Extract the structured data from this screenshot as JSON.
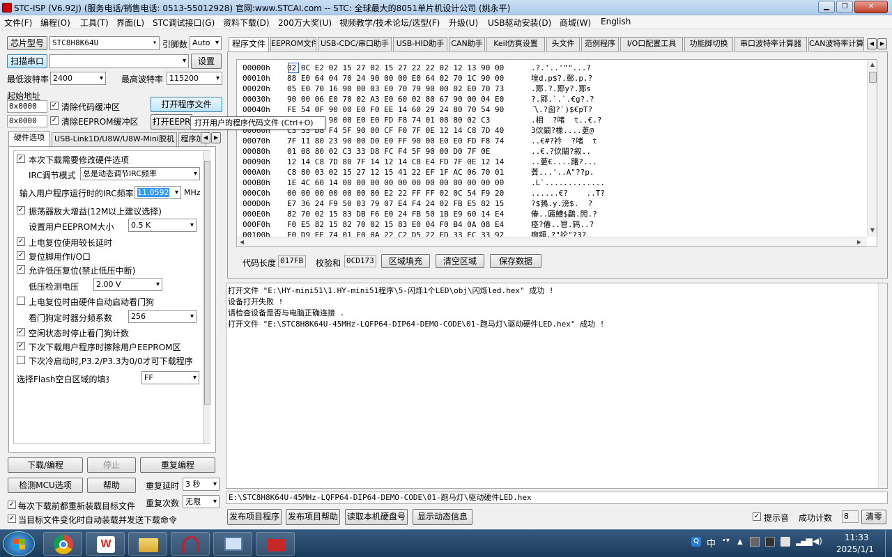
{
  "window": {
    "title": "STC-ISP (V6.92J) (服务电话/销售电话: 0513-55012928) 官网:www.STCAI.com  -- STC: 全球最大的8051单片机设计公司 (姚永平)"
  },
  "menu": [
    "文件(F)",
    "编程(O)",
    "工具(T)",
    "界面(L)",
    "STC调试接口(G)",
    "资料下载(D)",
    "200万大奖(U)",
    "视频教学/技术论坛/选型(F)",
    "升级(U)",
    "USB驱动安装(D)",
    "商城(W)",
    "English"
  ],
  "left": {
    "chip_label": "芯片型号",
    "chip_value": "STC8H8K64U",
    "pins_label": "引脚数",
    "pins_value": "Auto",
    "scan_label": "扫描串口",
    "port_value": "",
    "settings_label": "设置",
    "min_baud_label": "最低波特率",
    "min_baud_value": "2400",
    "max_baud_label": "最高波特率",
    "max_baud_value": "115200",
    "start_addr_label": "起始地址",
    "addr1": "0x0000",
    "clear_code_label": "清除代码缓冲区",
    "addr2": "0x0000",
    "clear_eeprom_label": "清除EEPROM缓冲区",
    "open_prog_label": "打开程序文件",
    "open_eeprom_label": "打开EEPR",
    "tooltip": "打开用户的程序代码文件 (Ctrl+O)",
    "subtabs": [
      "硬件选项",
      "USB-Link1D/U8W/U8W-Mini脱机",
      "程序加"
    ],
    "options": {
      "opt1": "本次下载需要修改硬件选项",
      "irc_mode_label": "IRC调节模式",
      "irc_mode_value": "总是动态调节IRC频率",
      "irc_freq_label": "输入用户程序运行时的IRC频率",
      "irc_freq_value": "11.0592",
      "irc_freq_unit": "MHz",
      "opt2": "振荡器放大增益(12M以上建议选择)",
      "eeprom_size_label": "设置用户EEPROM大小",
      "eeprom_size_value": "0.5 K",
      "opt3": "上电复位使用较长延时",
      "opt4": "复位脚用作I/O口",
      "opt5": "允许低压复位(禁止低压中断)",
      "lvd_label": "低压检测电压",
      "lvd_value": "2.00 V",
      "opt6": "上电复位时由硬件自动启动看门狗",
      "wdt_label": "看门狗定时器分频系数",
      "wdt_value": "256",
      "opt7": "空闲状态时停止看门狗计数",
      "opt8": "下次下载用户程序时擦除用户EEPROM区",
      "opt9": "下次冷启动时,P3.2/P3.3为0/0才可下载程序",
      "fill_label": "选择Flash空白区域的填充",
      "fill_value": "FF"
    },
    "download_label": "下载/编程",
    "stop_label": "停止",
    "reprog_label": "重复编程",
    "detect_label": "检测MCU选项",
    "help_label": "帮助",
    "repeat_delay_label": "重复延时",
    "repeat_delay_value": "3 秒",
    "repeat_count_label": "重复次数",
    "repeat_count_value": "无限",
    "reload_label": "每次下载前都重新装载目标文件",
    "autoload_label": "当目标文件变化时自动装载并发送下载命令"
  },
  "right": {
    "tabs": [
      "程序文件",
      "EEPROM文件",
      "USB-CDC/串口助手",
      "USB-HID助手",
      "CAN助手",
      "Keil仿真设置",
      "头文件",
      "范例程序",
      "I/O口配置工具",
      "功能脚切换",
      "串口波特率计算器",
      "CAN波特率计算"
    ],
    "hex_rows": [
      [
        "00000h",
        "02 0C E2 02 15 27 02 15 27 22 22 02 12 13 90 00",
        ".?.'..'\"\"...?"
      ],
      [
        "00010h",
        "88 E0 64 04 70 24 90 00 00 E0 64 02 70 1C 90 00",
        "埃d.p$?.鄣.p.?"
      ],
      [
        "00020h",
        "05 E0 70 16 90 00 03 E0 70 79 90 00 02 E0 70 73",
        ".鄍.?.鄍y?.鄍s"
      ],
      [
        "00030h",
        "90 00 06 E0 70 02 A3 E0 60 02 80 67 90 00 04 E0",
        "?.鄍.`.`.€g?.?"
      ],
      [
        "00040h",
        "FE 54 0F 90 00 E0 F0 EE 14 60 29 24 80 70 54 90",
        "乁.?囪?`)$€pT?"
      ],
      [
        "00050h",
        "00 E0 FF 90 00 E0 E0 FD F8 74 01 08 80 02 C3",
        ".相  ?啫  t..€.?"
      ],
      [
        "00060h",
        "C3 33 D8 F4 5F 90 00 CF F0 7F 0E 12 14 C8 7D 40",
        "3佽鬫?橡....茰@"
      ],
      [
        "00070h",
        "7F 11 80 23 90 00 D0 E0 FF 90 00 E0 E0 FD F8 74",
        "..€#?衿  ?啫  t"
      ],
      [
        "00080h",
        "01 08 80 02 C3 33 D8 FC F4 5F 90 00 D0 7F 0E",
        "..€.?佽鬫?叙.."
      ],
      [
        "00090h",
        "12 14 C8 7D 80 7F 14 12 14 C8 E4 FD 7F 0E 12 14",
        "..茰€....躇?..."
      ],
      [
        "000A0h",
        "C8 80 03 02 15 27 12 15 41 22 EF 1F AC 06 70 01",
        "葊...'..A\"??p."
      ],
      [
        "000B0h",
        "1E 4C 60 14 00 00 00 00 00 00 00 00 00 00 00 00",
        ".L`............."
      ],
      [
        "000C0h",
        "00 00 00 00 00 00 80 E2 22 FF FF 02 0C 54 F9 20",
        "......€?    ..T?"
      ],
      [
        "000D0h",
        "E7 36 24 F9 50 03 79 07 E4 F4 24 02 FB E5 82 15",
        "?$鵓.y.滂$.  ?"
      ],
      [
        "000E0h",
        "82 70 02 15 83 DB F6 E0 24 FB 50 1B E9 60 14 E4",
        "偆..匾鰽$鸓.閌.?"
      ],
      [
        "000F0h",
        "F0 E5 82 15 82 70 02 15 83 E0 04 F0 B4 0A 08 E4",
        "痉?偆..冟.鸫..?"
      ],
      [
        "00100h",
        "F0 D9 EE 74 01 F0 0A 22 C2 D5 22 ED 33 EC 33 92",
        "痂頮.?\"抡\"?3?"
      ]
    ],
    "code_len_label": "代码长度",
    "code_len_value": "017FB",
    "checksum_label": "校验和",
    "checksum_value": "0CD173",
    "fill_btn": "区域填充",
    "clear_btn": "清空区域",
    "save_btn": "保存数据",
    "log": [
      "打开文件 \"E:\\HY-mini51\\1.HY-mini51程序\\5-闪烁1个LED\\obj\\闪烁led.hex\" 成功 !",
      "设备打开失败 !",
      "请检查设备是否与电脑正确连接 .",
      "打开文件 \"E:\\STC8H8K64U-45MHz-LQFP64-DIP64-DEMO-CODE\\01-跑马灯\\驱动硬件LED.hex\" 成功 !"
    ],
    "path": "E:\\STC8H8K64U-45MHz-LQFP64-DIP64-DEMO-CODE\\01-跑马灯\\驱动硬件LED.hex",
    "publish_prog": "发布项目程序",
    "publish_help": "发布项目帮助",
    "read_disk": "读取本机硬盘号",
    "show_dyn": "显示动态信息",
    "beep_label": "提示音",
    "success_label": "成功计数",
    "success_value": "8",
    "clear_label": "清零"
  },
  "taskbar": {
    "ime": "中",
    "time": "11:33",
    "date": "2025/1/1"
  }
}
